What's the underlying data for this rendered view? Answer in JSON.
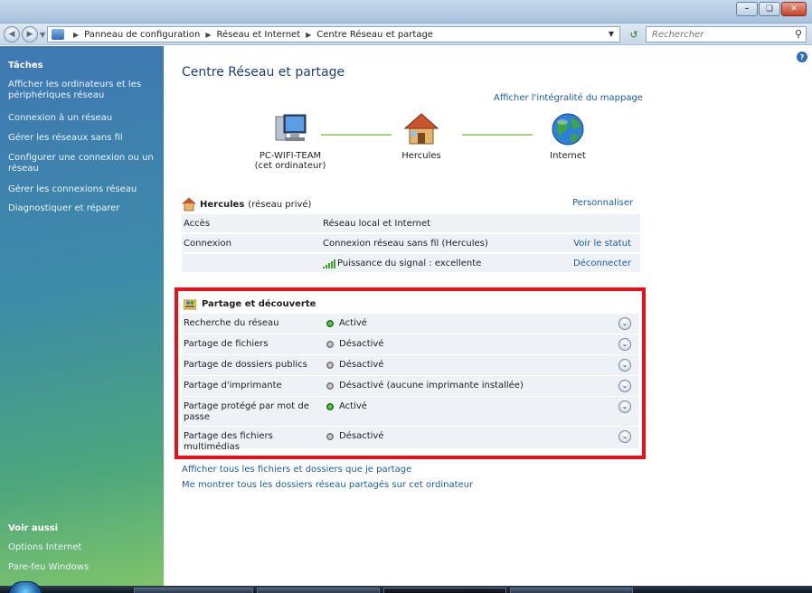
{
  "window": {
    "minimize_icon": "minimize-icon",
    "maximize_icon": "maximize-icon",
    "close_icon": "close-icon"
  },
  "address": {
    "crumbs": [
      "Panneau de configuration",
      "Réseau et Internet",
      "Centre Réseau et partage"
    ],
    "search_placeholder": "Rechercher"
  },
  "sidebar": {
    "tasks_heading": "Tâches",
    "tasks": [
      "Afficher les ordinateurs et les périphériques réseau",
      "Connexion à un réseau",
      "Gérer les réseaux sans fil",
      "Configurer une connexion ou un réseau",
      "Gérer les connexions réseau",
      "Diagnostiquer et réparer"
    ],
    "see_also_heading": "Voir aussi",
    "see_also": [
      "Options Internet",
      "Pare-feu Windows"
    ]
  },
  "main": {
    "title": "Centre Réseau et partage",
    "full_map_link": "Afficher l'intégralité du mappage",
    "map": {
      "computer_name": "PC-WIFI-TEAM",
      "computer_sub": "(cet ordinateur)",
      "network_name": "Hercules",
      "internet": "Internet"
    },
    "network": {
      "name": "Hercules",
      "type": "(réseau privé)",
      "customize": "Personnaliser",
      "rows": [
        {
          "label": "Accès",
          "value": "Réseau local et Internet",
          "action": ""
        },
        {
          "label": "Connexion",
          "value": "Connexion réseau sans fil (Hercules)",
          "action": "Voir le statut"
        },
        {
          "label": "",
          "value": "Puissance du signal : excellente",
          "action": "Déconnecter"
        }
      ]
    },
    "sharing": {
      "title": "Partage et découverte",
      "rows": [
        {
          "label": "Recherche du réseau",
          "status": "Activé",
          "state": "on"
        },
        {
          "label": "Partage de fichiers",
          "status": "Désactivé",
          "state": "off"
        },
        {
          "label": "Partage de dossiers publics",
          "status": "Désactivé",
          "state": "off"
        },
        {
          "label": "Partage d'imprimante",
          "status": "Désactivé (aucune imprimante installée)",
          "state": "off"
        },
        {
          "label": "Partage protégé par mot de passe",
          "status": "Activé",
          "state": "on"
        },
        {
          "label": "Partage des fichiers multimédias",
          "status": "Désactivé",
          "state": "off"
        }
      ]
    },
    "bottom_links": [
      "Afficher tous les fichiers et dossiers que je partage",
      "Me montrer tous les dossiers réseau partagés sur cet ordinateur"
    ]
  },
  "colors": {
    "highlight_border": "#e8101a",
    "link": "#1a5ba6",
    "status_on": "#2a8c1c",
    "status_off": "#8a8a8a"
  }
}
